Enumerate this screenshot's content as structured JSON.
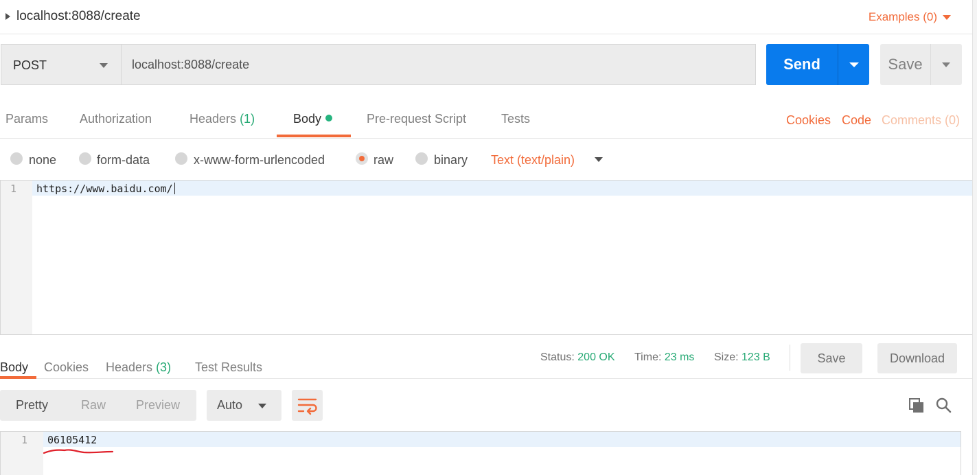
{
  "header": {
    "title": "localhost:8088/create",
    "examples_label": "Examples (0)"
  },
  "request": {
    "method": "POST",
    "url": "localhost:8088/create",
    "send_label": "Send",
    "save_label": "Save"
  },
  "request_tabs": {
    "params": "Params",
    "authorization": "Authorization",
    "headers": "Headers",
    "headers_count": "(1)",
    "body": "Body",
    "prerequest": "Pre-request Script",
    "tests": "Tests",
    "cookies": "Cookies",
    "code": "Code",
    "comments": "Comments (0)"
  },
  "body_types": {
    "none": "none",
    "form_data": "form-data",
    "urlencoded": "x-www-form-urlencoded",
    "raw": "raw",
    "binary": "binary",
    "selected": "raw",
    "content_type": "Text (text/plain)"
  },
  "request_editor": {
    "line_number": "1",
    "content": "https://www.baidu.com/"
  },
  "response_tabs": {
    "body": "Body",
    "cookies": "Cookies",
    "headers": "Headers",
    "headers_count": "(3)",
    "test_results": "Test Results"
  },
  "response_meta": {
    "status_label": "Status:",
    "status_value": "200 OK",
    "time_label": "Time:",
    "time_value": "23 ms",
    "size_label": "Size:",
    "size_value": "123 B",
    "save_label": "Save",
    "download_label": "Download"
  },
  "response_toolbar": {
    "pretty": "Pretty",
    "raw": "Raw",
    "preview": "Preview",
    "format": "Auto"
  },
  "response_editor": {
    "line_number": "1",
    "content": "06105412"
  },
  "colors": {
    "accent": "#f26b3a",
    "send_blue": "#097bed",
    "success_green": "#26a974",
    "annotation_red": "#e0202a"
  }
}
